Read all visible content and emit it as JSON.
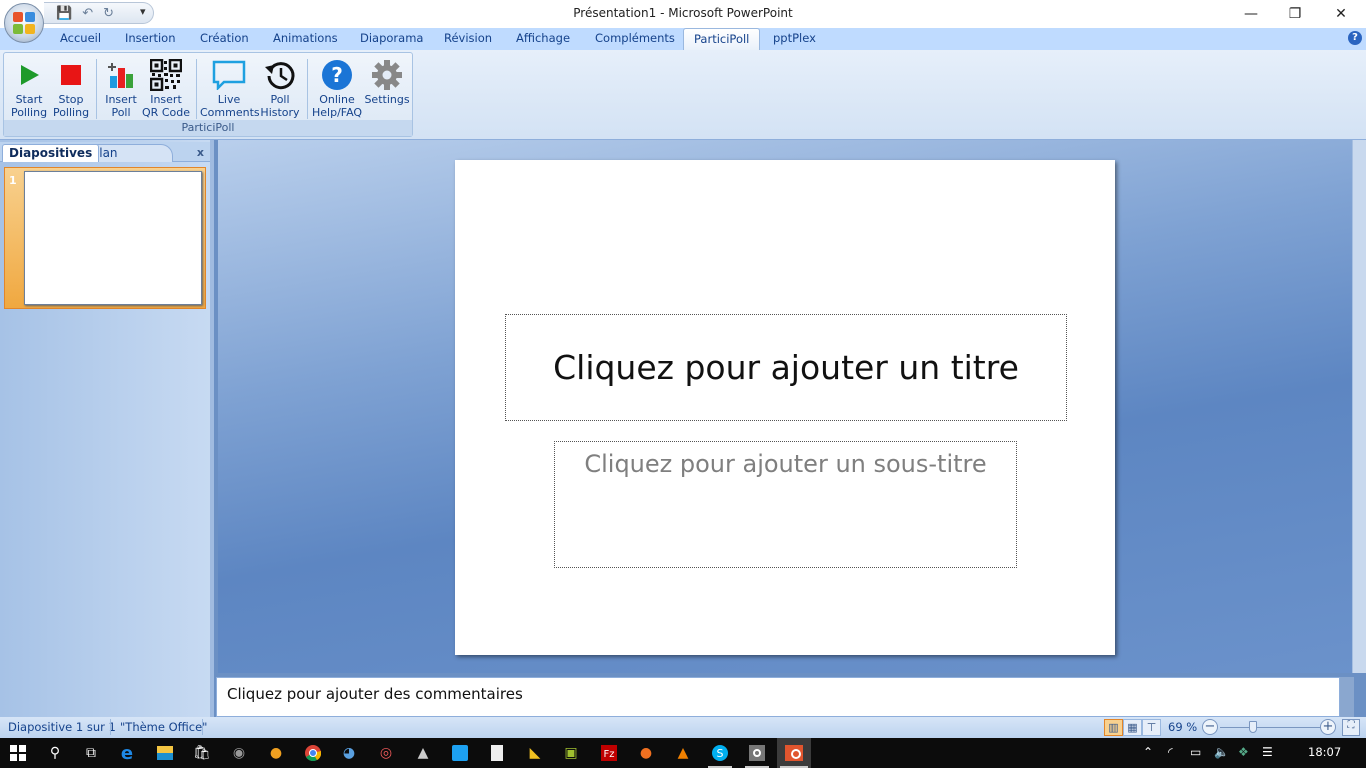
{
  "window": {
    "title": "Présentation1 - Microsoft PowerPoint",
    "minimize": "—",
    "restore": "❐",
    "close": "✕"
  },
  "qat": {
    "save": "💾",
    "undo": "↶",
    "undo_drop": "▾",
    "redo": "↻",
    "more": "▾"
  },
  "tabs": [
    "Accueil",
    "Insertion",
    "Création",
    "Animations",
    "Diaporama",
    "Révision",
    "Affichage",
    "Compléments",
    "ParticiPoll",
    "pptPlex"
  ],
  "active_tab": "ParticiPoll",
  "help": "?",
  "ribbon": {
    "group_label": "ParticiPoll",
    "buttons": [
      {
        "line1": "Start",
        "line2": "Polling",
        "icon": "play-icon"
      },
      {
        "line1": "Stop",
        "line2": "Polling",
        "icon": "stop-icon"
      },
      {
        "line1": "Insert",
        "line2": "Poll",
        "icon": "insert-poll-icon"
      },
      {
        "line1": "Insert",
        "line2": "QR Code",
        "icon": "qr-code-icon"
      },
      {
        "line1": "Live",
        "line2": "Comments",
        "icon": "comment-icon"
      },
      {
        "line1": "Poll",
        "line2": "History",
        "icon": "history-icon"
      },
      {
        "line1": "Online",
        "line2": "Help/FAQ",
        "icon": "help-icon"
      },
      {
        "line1": "Settings",
        "line2": "",
        "icon": "gear-icon"
      }
    ]
  },
  "pane": {
    "tab_slides": "Diapositives",
    "tab_plan": "Plan",
    "close": "x",
    "slide_number": "1"
  },
  "slide": {
    "title_placeholder": "Cliquez pour ajouter un titre",
    "subtitle_placeholder": "Cliquez pour ajouter un sous-titre"
  },
  "notes": {
    "placeholder": "Cliquez pour ajouter des commentaires"
  },
  "status": {
    "slide_info": "Diapositive 1 sur 1",
    "theme": "\"Thème Office\"",
    "zoom": "69 %",
    "zoom_level": 0.69,
    "zoom_minus": "−",
    "zoom_plus": "+"
  },
  "taskbar": {
    "apps": [
      "start",
      "search",
      "task-view",
      "edge",
      "file-explorer",
      "store",
      "gimp",
      "audacity",
      "chrome",
      "thunderbird",
      "app-red",
      "inkscape",
      "twitter",
      "notepad",
      "app-yellow",
      "app-green",
      "filezilla",
      "firefox",
      "vlc",
      "skype",
      "settings",
      "powerpoint"
    ],
    "clock": "18:07"
  },
  "colors": {
    "accent": "#15428b",
    "ribbon_bg": "#bfdbff",
    "selected": "#f0a840"
  }
}
